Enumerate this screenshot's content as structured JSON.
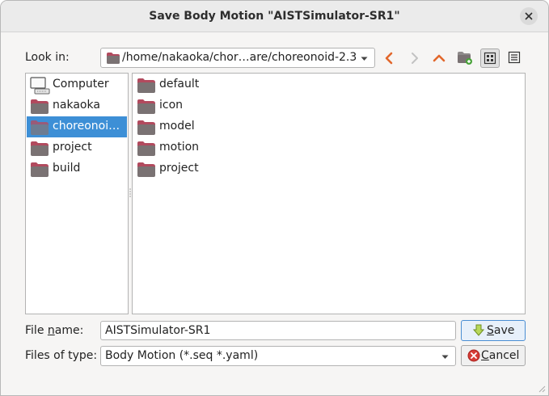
{
  "window": {
    "title": "Save Body Motion \"AISTSimulator-SR1\""
  },
  "look_in": {
    "label": "Look in:",
    "path": "/home/nakaoka/chor…are/choreonoid-2.3"
  },
  "toolbar": {
    "back_icon": "arrow-left-icon",
    "forward_icon": "arrow-right-icon",
    "parent_icon": "arrow-up-icon",
    "new_folder_icon": "new-folder-icon",
    "list_view_icon": "list-mode-icon",
    "detail_view_icon": "detail-mode-icon"
  },
  "sidebar": {
    "items": [
      {
        "label": "Computer",
        "icon": "computer-icon"
      },
      {
        "label": "nakaoka",
        "icon": "folder-icon"
      },
      {
        "label": "choreonoi…",
        "icon": "folder-icon",
        "selected": true
      },
      {
        "label": "project",
        "icon": "folder-icon"
      },
      {
        "label": "build",
        "icon": "folder-icon"
      }
    ]
  },
  "files": {
    "items": [
      {
        "label": "default",
        "icon": "folder-icon"
      },
      {
        "label": "icon",
        "icon": "folder-icon"
      },
      {
        "label": "model",
        "icon": "folder-icon"
      },
      {
        "label": "motion",
        "icon": "folder-icon"
      },
      {
        "label": "project",
        "icon": "folder-icon"
      }
    ]
  },
  "file_name": {
    "label_prefix": "File ",
    "label_mnemonic": "n",
    "label_suffix": "ame:",
    "value": "AISTSimulator-SR1"
  },
  "file_type": {
    "label": "Files of type:",
    "value": "Body Motion (*.seq *.yaml)"
  },
  "buttons": {
    "save_mnemonic": "S",
    "save_rest": "ave",
    "cancel_mnemonic": "C",
    "cancel_rest": "ancel"
  },
  "colors": {
    "selection": "#3d8fd6",
    "folder_top": "#b24a5e",
    "folder_body": "#7a7273",
    "nav_arrow": "#e2672b",
    "save_arrow": "#8bb52e",
    "cancel_icon": "#c9302c"
  }
}
